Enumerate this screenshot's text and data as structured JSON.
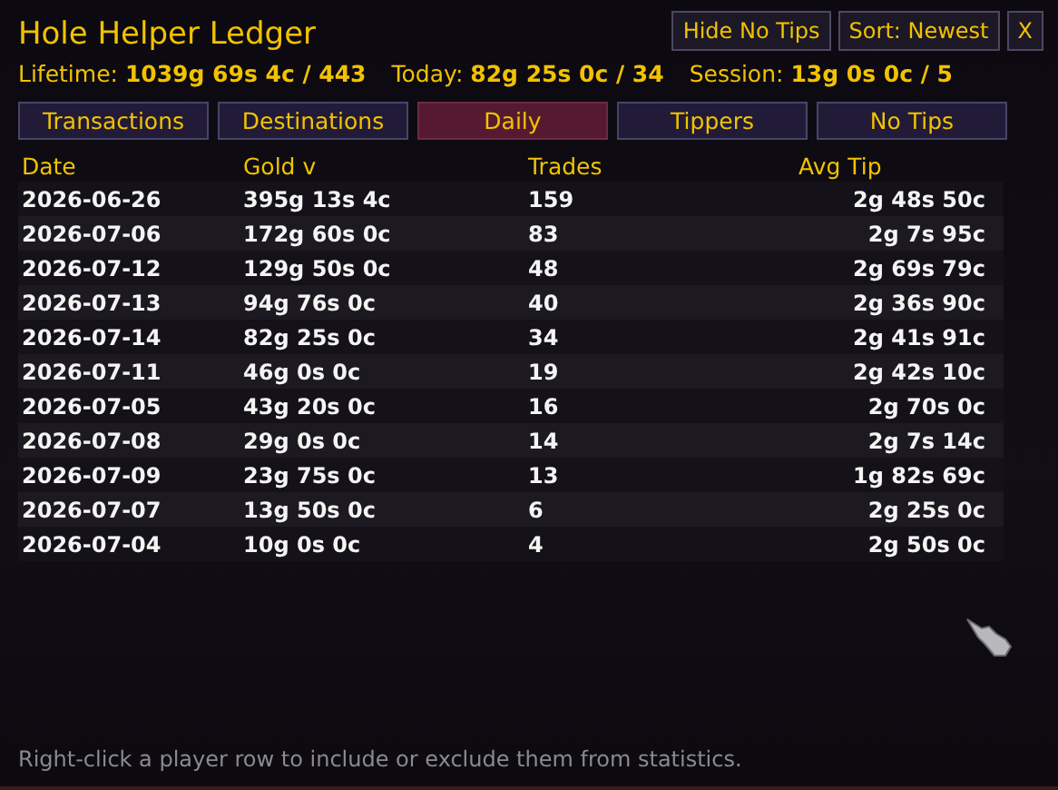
{
  "window": {
    "title": "Hole Helper Ledger"
  },
  "header_buttons": [
    {
      "label": "Hide No Tips"
    },
    {
      "label": "Sort: Newest"
    },
    {
      "label": "X"
    }
  ],
  "stats": [
    {
      "label": "Lifetime:",
      "value": "1039g 69s 4c / 443"
    },
    {
      "label": "Today:",
      "value": "82g 25s 0c / 34"
    },
    {
      "label": "Session:",
      "value": "13g 0s 0c / 5"
    }
  ],
  "tabs": [
    {
      "label": "Transactions",
      "selected": false
    },
    {
      "label": "Destinations",
      "selected": false
    },
    {
      "label": "Daily",
      "selected": true
    },
    {
      "label": "Tippers",
      "selected": false
    },
    {
      "label": "No Tips",
      "selected": false
    }
  ],
  "table": {
    "columns": [
      "Date",
      "Gold v",
      "Trades",
      "Avg Tip"
    ],
    "rows": [
      [
        "2026-06-26",
        "395g 13s 4c",
        "159",
        "2g 48s 50c"
      ],
      [
        "2026-07-06",
        "172g 60s 0c",
        "83",
        "2g 7s 95c"
      ],
      [
        "2026-07-12",
        "129g 50s 0c",
        "48",
        "2g 69s 79c"
      ],
      [
        "2026-07-13",
        "94g 76s 0c",
        "40",
        "2g 36s 90c"
      ],
      [
        "2026-07-14",
        "82g 25s 0c",
        "34",
        "2g 41s 91c"
      ],
      [
        "2026-07-11",
        "46g 0s 0c",
        "19",
        "2g 42s 10c"
      ],
      [
        "2026-07-05",
        "43g 20s 0c",
        "16",
        "2g 70s 0c"
      ],
      [
        "2026-07-08",
        "29g 0s 0c",
        "14",
        "2g 7s 14c"
      ],
      [
        "2026-07-09",
        "23g 75s 0c",
        "13",
        "1g 82s 69c"
      ],
      [
        "2026-07-07",
        "13g 50s 0c",
        "6",
        "2g 25s 0c"
      ],
      [
        "2026-07-04",
        "10g 0s 0c",
        "4",
        "2g 50s 0c"
      ]
    ]
  },
  "status_bar": "Right-click a player row to include or exclude them from statistics."
}
